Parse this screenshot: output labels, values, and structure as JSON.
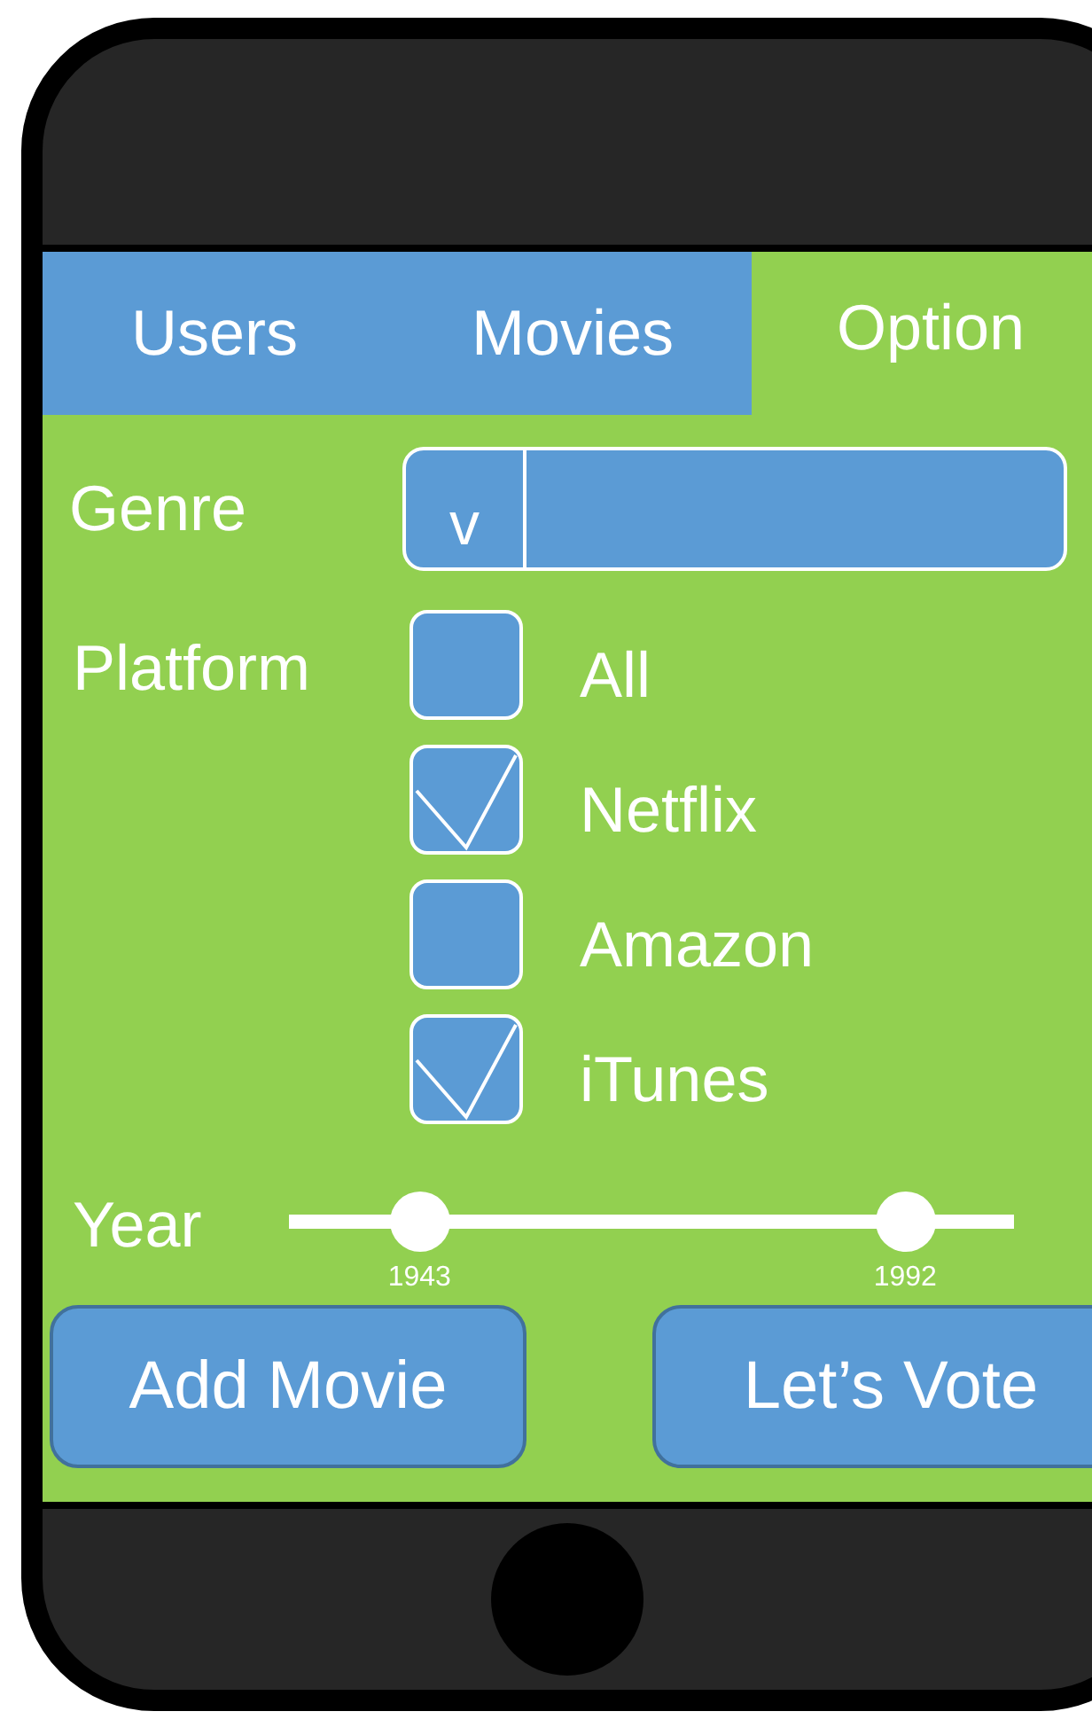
{
  "tabs": [
    {
      "label": "Users",
      "selected": false
    },
    {
      "label": "Movies",
      "selected": false
    },
    {
      "label": "Option",
      "selected": true
    }
  ],
  "genre": {
    "label": "Genre",
    "toggle": "v"
  },
  "platform": {
    "label": "Platform",
    "options": [
      {
        "label": "All",
        "checked": false
      },
      {
        "label": "Netflix",
        "checked": true
      },
      {
        "label": "Amazon",
        "checked": false
      },
      {
        "label": "iTunes",
        "checked": true
      }
    ]
  },
  "year": {
    "label": "Year",
    "thumbs": [
      {
        "level": 0.18,
        "value": "1943"
      },
      {
        "level": 0.85,
        "value": "1992"
      }
    ]
  },
  "buttons": [
    "Add Movie",
    "Let’s Vote"
  ]
}
